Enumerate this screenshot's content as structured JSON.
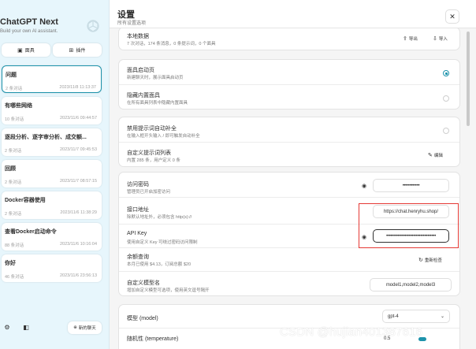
{
  "sidebar": {
    "brand_title": "ChatGPT Next",
    "brand_subtitle": "Build your own AI assistant.",
    "buttons": [
      {
        "icon": "mask-icon",
        "label": "面具"
      },
      {
        "icon": "plugin-icon",
        "label": "插件"
      }
    ],
    "chats": [
      {
        "title": "问题",
        "count": "2 条对话",
        "time": "2023/11/8 11:13:37"
      },
      {
        "title": "有哪些网络",
        "count": "10 条对话",
        "time": "2023/11/6 09:44:57"
      },
      {
        "title": "逐段分析、逐字审分析、成交额...",
        "count": "2 条对话",
        "time": "2023/11/7 09:45:53"
      },
      {
        "title": "回顾",
        "count": "2 条对话",
        "time": "2023/11/7 08:57:15"
      },
      {
        "title": "Docker容器使用",
        "count": "2 条对话",
        "time": "2023/11/6 11:38:29"
      },
      {
        "title": "查看Docker启动命令",
        "count": "88 条对话",
        "time": "2023/11/6 10:16:04"
      },
      {
        "title": "你好",
        "count": "46 条对话",
        "time": "2023/11/6 23:56:13"
      }
    ],
    "footer": {
      "new_chat": "新的聊天"
    }
  },
  "main": {
    "title": "设置",
    "subtitle": "所有设置选项",
    "card1": {
      "title": "本地数据",
      "subtitle": "7 次对话，174 条消息，0 条提示词，0 个面具",
      "export": "导出",
      "import": "导入"
    },
    "card2": {
      "rows": [
        {
          "title": "面具启动页",
          "subtitle": "新建聊天时，展示面具启动页",
          "checked": true
        },
        {
          "title": "隐藏内置面具",
          "subtitle": "在所有面具列表中隐藏内置面具",
          "checked": false
        }
      ]
    },
    "card3": {
      "autocomplete_title": "禁用提示词自动补全",
      "autocomplete_subtitle": "在输入框开头输入 / 即可触发自动补全",
      "prompt_title": "自定义提示词列表",
      "prompt_subtitle": "内置 285 条，用户定义 0 条",
      "edit": "编辑"
    },
    "card4": {
      "access_title": "访问密码",
      "access_subtitle": "管理员已开启加密访问",
      "access_value": "••••••••••••",
      "endpoint_title": "接口地址",
      "endpoint_subtitle": "除默认地址外，必须包含 http(s)://",
      "endpoint_value": "https://chat.henryhu.shop/",
      "apikey_title": "API Key",
      "apikey_subtitle": "使用自定义 Key 可绕过密码访问限制",
      "apikey_value": "•••••••••••••••••••••••••••••••••••",
      "balance_title": "余额查询",
      "balance_subtitle": "本月已使用 $4.13，订阅总额 $20",
      "balance_action": "重新检查",
      "models_title": "自定义模型名",
      "models_subtitle": "增加自定义模型可选项，使用英文逗号隔开",
      "models_value": "model1,model2,model3"
    },
    "card5": {
      "model_title": "模型 (model)",
      "model_value": "gpt-4",
      "temp_title": "随机性 (temperature)",
      "temp_value": "0.5"
    }
  },
  "watermark": "CSDN @hujian401387616",
  "colors": {
    "accent": "#1d93ab",
    "sidebar_bg": "#e7f6fc",
    "highlight": "#e53935"
  }
}
